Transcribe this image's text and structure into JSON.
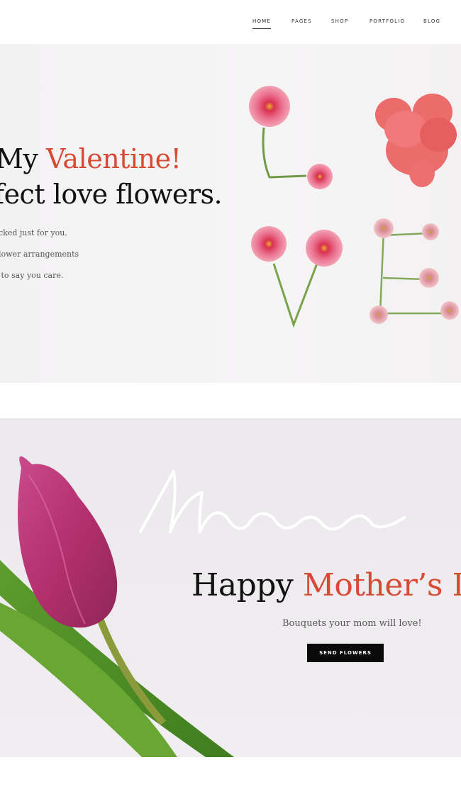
{
  "nav": {
    "items": [
      {
        "label": "HOME",
        "active": true
      },
      {
        "label": "PAGES"
      },
      {
        "label": "SHOP"
      },
      {
        "label": "PORTFOLIO"
      },
      {
        "label": "BLOG"
      }
    ]
  },
  "hero_valentine": {
    "headline_start": "My ",
    "headline_accent": "Valentine!",
    "headline_line2": "fect love flowers.",
    "lines": [
      "cked just for you.",
      "lower arrangements",
      " to say you care."
    ],
    "image": "love-flower-letters"
  },
  "hero_mom": {
    "script_word": "Mom",
    "title_start": "Happy ",
    "title_accent": "Mother’s Da",
    "subtitle": "Bouquets your mom will love!",
    "button_label": "SEND FLOWERS",
    "image": "pink-tulip"
  },
  "colors": {
    "accent": "#d94a35",
    "button_bg": "#0a0a0a",
    "text": "#111111"
  }
}
